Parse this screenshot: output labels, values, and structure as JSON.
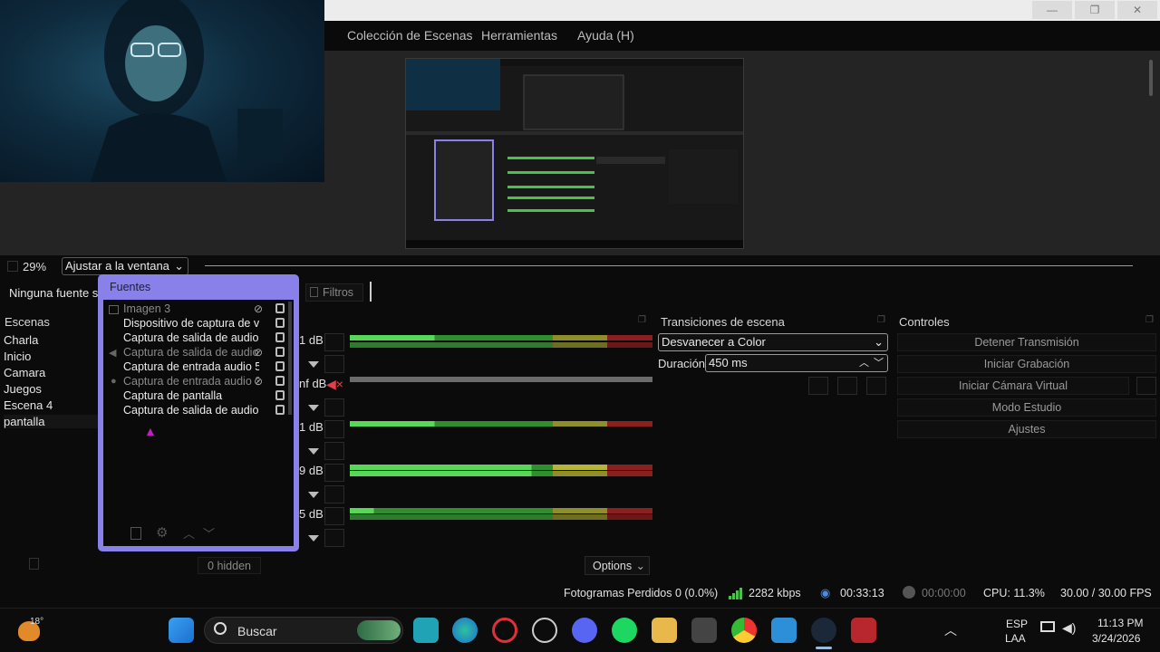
{
  "window": {
    "controls": [
      "—",
      "❐",
      "✕"
    ]
  },
  "menu": [
    "Colección de Escenas",
    "Herramientas",
    "Ayuda (H)"
  ],
  "zoom": {
    "percent": "29%",
    "mode": "Ajustar a la ventana"
  },
  "source_toolbar": {
    "no_source": "Ninguna fuente se",
    "filters": "Filtros"
  },
  "scenes": {
    "title": "Escenas",
    "items": [
      "Charla",
      "Inicio",
      "Camara",
      "Juegos",
      "Escena 4",
      "pantalla"
    ]
  },
  "sources": {
    "title": "Fuentes",
    "items": [
      {
        "label": "Imagen 3",
        "hidden": true,
        "icon": "image-icon"
      },
      {
        "label": "Dispositivo de captura de v",
        "hidden": false,
        "icon": ""
      },
      {
        "label": "Captura de salida de audio",
        "hidden": false,
        "icon": ""
      },
      {
        "label": "Captura de salida de audio",
        "hidden": true,
        "icon": "speaker-icon"
      },
      {
        "label": "Captura de entrada audio 5",
        "hidden": false,
        "icon": ""
      },
      {
        "label": "Captura de entrada audio 3",
        "hidden": true,
        "icon": "mic-icon"
      },
      {
        "label": "Captura de pantalla",
        "hidden": false,
        "icon": ""
      },
      {
        "label": "Captura de salida de audio",
        "hidden": false,
        "icon": ""
      }
    ],
    "hidden_count": "0 hidden"
  },
  "mixer": {
    "rows": [
      {
        "db": "1 dB",
        "level": 0.35,
        "muted": false
      },
      {
        "db": "nf dB",
        "level": 0,
        "muted": true
      },
      {
        "db": "1 dB",
        "level": 0.3,
        "muted": false
      },
      {
        "db": "9 dB",
        "level": 0.6,
        "muted": false
      },
      {
        "db": "5 dB",
        "level": 0.15,
        "muted": false
      }
    ],
    "options": "Options"
  },
  "transitions": {
    "title": "Transiciones de escena",
    "selected": "Desvanecer a Color",
    "duration_label": "Duración",
    "duration": "450 ms"
  },
  "controls": {
    "title": "Controles",
    "buttons": [
      "Detener Transmisión",
      "Iniciar Grabación",
      "Iniciar Cámara Virtual",
      "Modo Estudio",
      "Ajustes"
    ]
  },
  "status": {
    "dropped": "Fotogramas Perdidos 0 (0.0%)",
    "kbps": "2282 kbps",
    "stream_time": "00:33:13",
    "rec_time": "00:00:00",
    "cpu": "CPU: 11.3%",
    "fps": "30.00 / 30.00 FPS"
  },
  "taskbar": {
    "weather": "18°",
    "search": "Buscar",
    "lang_top": "ESP",
    "lang_bottom": "LAA",
    "time": "11:13 PM",
    "date": "3/24/2026"
  },
  "colors": {
    "accent": "#8a80ea",
    "meter_green": "#57d957",
    "meter_red": "#8c1f1f",
    "mute_red": "#e0404a"
  }
}
